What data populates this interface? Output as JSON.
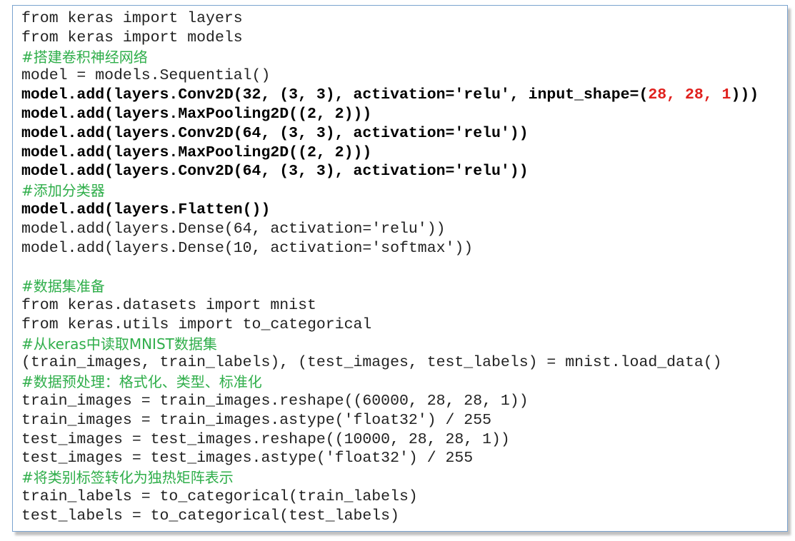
{
  "colors": {
    "comment": "#2fae4a",
    "code": "#222222",
    "highlight_number": "#e0201d",
    "frame_border": "#7aa3cf"
  },
  "code": {
    "lines": [
      {
        "text": "from keras import layers",
        "style": "normal"
      },
      {
        "text": "from keras import models",
        "style": "normal"
      },
      {
        "text": "#搭建卷积神经网络",
        "style": "comment"
      },
      {
        "text": "model = models.Sequential()",
        "style": "normal"
      },
      {
        "text": "model.add(layers.Conv2D(32, (3, 3), activation='relu', input_shape=(",
        "style": "bold",
        "highlight": "28, 28, 1",
        "suffix": ")))"
      },
      {
        "text": "model.add(layers.MaxPooling2D((2, 2)))",
        "style": "bold"
      },
      {
        "text": "model.add(layers.Conv2D(64, (3, 3), activation='relu'))",
        "style": "bold"
      },
      {
        "text": "model.add(layers.MaxPooling2D((2, 2)))",
        "style": "bold"
      },
      {
        "text": "model.add(layers.Conv2D(64, (3, 3), activation='relu'))",
        "style": "bold"
      },
      {
        "text": "#添加分类器",
        "style": "comment"
      },
      {
        "text": "model.add(layers.Flatten())",
        "style": "bold"
      },
      {
        "text": "model.add(layers.Dense(64, activation='relu'))",
        "style": "normal"
      },
      {
        "text": "model.add(layers.Dense(10, activation='softmax'))",
        "style": "normal"
      },
      {
        "text": "",
        "style": "normal"
      },
      {
        "text": "#数据集准备",
        "style": "comment"
      },
      {
        "text": "from keras.datasets import mnist",
        "style": "normal"
      },
      {
        "text": "from keras.utils import to_categorical",
        "style": "normal"
      },
      {
        "text": "#从keras中读取MNIST数据集",
        "style": "comment"
      },
      {
        "text": "(train_images, train_labels), (test_images, test_labels) = mnist.load_data()",
        "style": "normal"
      },
      {
        "text": "#数据预处理：格式化、类型、标准化",
        "style": "comment"
      },
      {
        "text": "train_images = train_images.reshape((60000, 28, 28, 1))",
        "style": "normal"
      },
      {
        "text": "train_images = train_images.astype('float32') / 255",
        "style": "normal"
      },
      {
        "text": "test_images = test_images.reshape((10000, 28, 28, 1))",
        "style": "normal"
      },
      {
        "text": "test_images = test_images.astype('float32') / 255",
        "style": "normal"
      },
      {
        "text": "#将类别标签转化为独热矩阵表示",
        "style": "comment"
      },
      {
        "text": "train_labels = to_categorical(train_labels)",
        "style": "normal"
      },
      {
        "text": "test_labels = to_categorical(test_labels)",
        "style": "normal"
      }
    ]
  }
}
